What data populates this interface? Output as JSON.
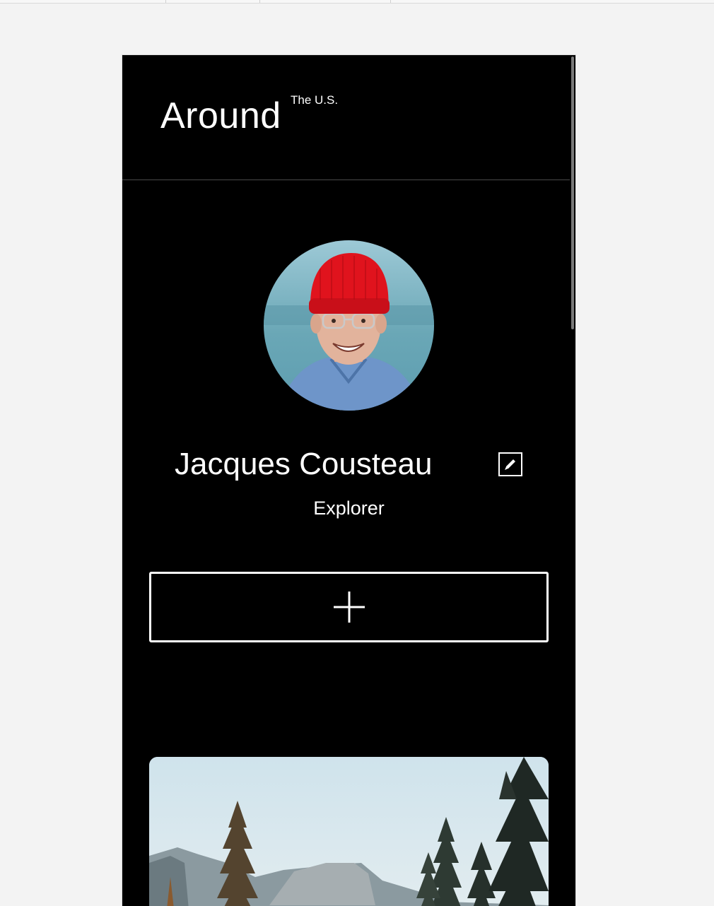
{
  "header": {
    "logo_main": "Around",
    "logo_sup": "The U.S."
  },
  "profile": {
    "name": "Jacques Cousteau",
    "job": "Explorer",
    "avatar_icon": "person-red-cap-photo",
    "edit_icon": "pencil-icon"
  },
  "actions": {
    "add_icon": "plus-icon"
  },
  "card": {
    "image_icon": "forest-mountain-photo"
  },
  "colors": {
    "background": "#000000",
    "text": "#ffffff",
    "page": "#f3f3f3"
  }
}
